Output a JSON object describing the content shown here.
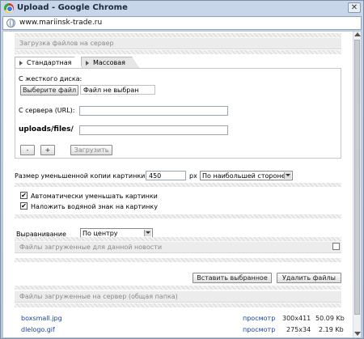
{
  "window": {
    "title": "Upload - Google Chrome",
    "close_glyph": "✕"
  },
  "address": {
    "url": "www.mariinsk-trade.ru"
  },
  "sections": {
    "upload_header": "Загрузка файлов на сервер",
    "news_files": "Файлы загруженные для данной новости",
    "server_files": "Файлы загруженные на сервер (общая папка)"
  },
  "tabs": [
    {
      "label": "Стандартная",
      "active": true
    },
    {
      "label": "Массовая",
      "active": false
    }
  ],
  "upload_panel": {
    "from_disk_label": "С жесткого диска:",
    "choose_file_button": "Выберите файл",
    "no_file_text": "Файл не выбран",
    "from_url_label": "С сервера (URL):",
    "url_value": "",
    "path_label": "uploads/files/",
    "path_value": "",
    "minus_button": "-",
    "plus_button": "+",
    "upload_button": "Загрузить"
  },
  "thumb": {
    "label": "Размер уменьшенной копии картинки:",
    "size_value": "450",
    "unit": "px",
    "side_option": "По наибольшей стороне"
  },
  "options": {
    "auto_resize": {
      "label": "Автоматически уменьшать картинки",
      "checked": true,
      "mark": "✔"
    },
    "watermark": {
      "label": "Наложить водяной знак на картинку",
      "checked": true,
      "mark": "✔"
    }
  },
  "align": {
    "label": "Выравнивание",
    "value": "По центру"
  },
  "actions": {
    "insert_selected": "Вставить выбранное",
    "delete_files": "Удалить файлы"
  },
  "files": [
    {
      "name": "boxsmall.jpg",
      "view": "просмотр",
      "dims": "300x411",
      "size": "50.09 Kb"
    },
    {
      "name": "dlelogo.gif",
      "view": "просмотр",
      "dims": "275x34",
      "size": "2.19 Kb"
    }
  ]
}
